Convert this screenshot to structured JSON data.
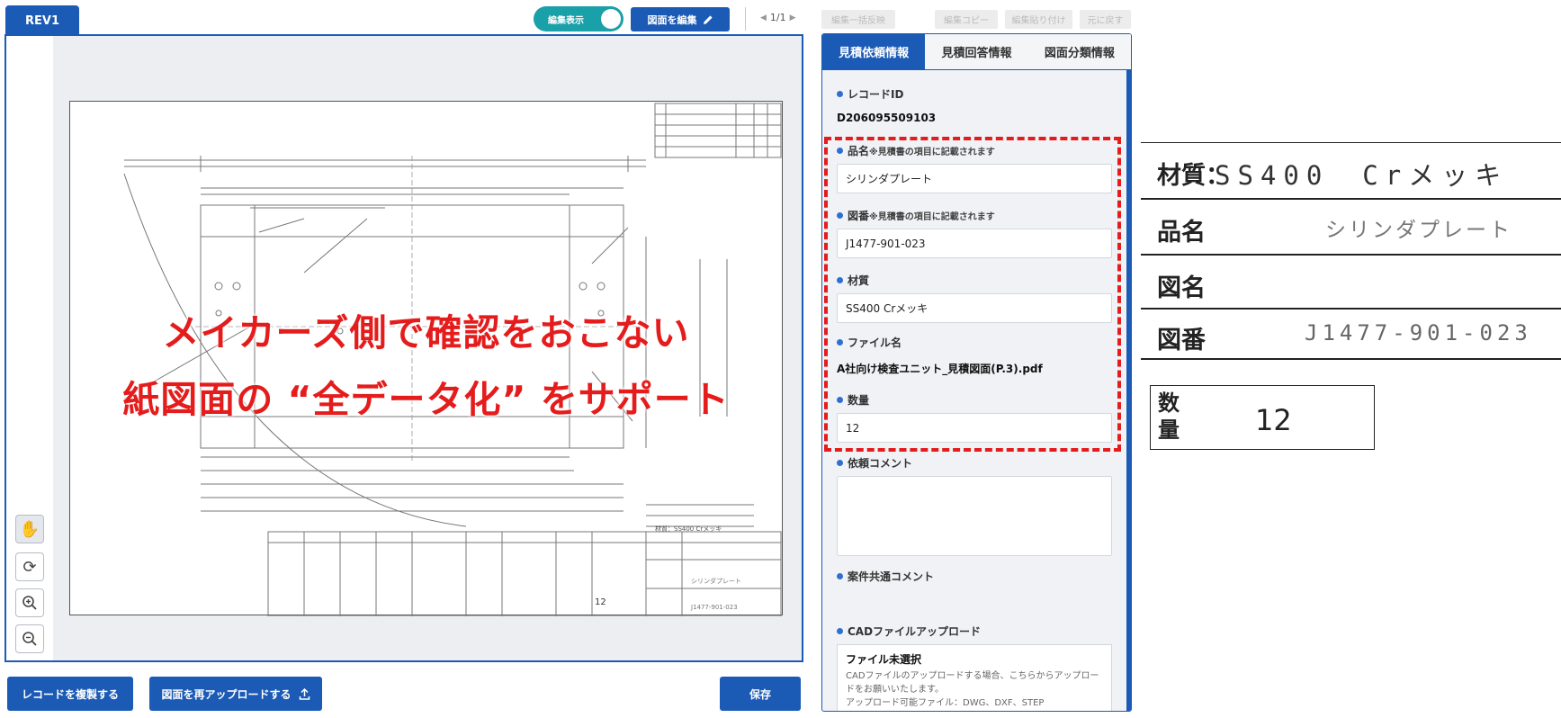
{
  "viewer": {
    "rev_tab": "REV1",
    "toggle_label": "編集表示",
    "edit_drawing_button": "図面を編集",
    "page_indicator": "1/1",
    "overlay_line1": "メイカーズ側で確認をおこない",
    "overlay_line2": "紙図面の “全データ化” をサポート",
    "drawing_material_note": "材質：SS400 Crメッキ",
    "drawing_quantity": "12",
    "drawing_part_name": "シリンダプレート",
    "drawing_number": "J1477-901-023"
  },
  "toolbar": {
    "bulk_apply": "編集一括反映",
    "copy_edit": "編集コピー",
    "paste_edit": "編集貼り付け",
    "undo": "元に戻す"
  },
  "bottom_buttons": {
    "duplicate_record": "レコードを複製する",
    "reupload_drawing": "図面を再アップロードする",
    "save": "保存"
  },
  "panel": {
    "tabs": [
      "見積依頼情報",
      "見積回答情報",
      "図面分類情報"
    ],
    "active_tab": 0,
    "record_id_label": "レコードID",
    "record_id_value": "D206095509103",
    "part_name_label": "品名",
    "part_name_note": "※見積書の項目に記載されます",
    "part_name_value": "シリンダプレート",
    "drawing_no_label": "図番",
    "drawing_no_note": "※見積書の項目に記載されます",
    "drawing_no_value": "J1477-901-023",
    "material_label": "材質",
    "material_value": "SS400 Crメッキ",
    "file_name_label": "ファイル名",
    "file_name_value": "A社向け検査ユニット_見積図面(P.3).pdf",
    "quantity_label": "数量",
    "quantity_value": "12",
    "request_comment_label": "依頼コメント",
    "shared_comment_label": "案件共通コメント",
    "cad_upload_label": "CADファイルアップロード",
    "cad_status": "ファイル未選択",
    "cad_desc_1": "CADファイルのアップロードする場合、こちらからアップロードをお願いいたします。",
    "cad_desc_2": "アップロード可能ファイル：DWG、DXF、STEP"
  },
  "zoom": {
    "material_label": "材質：",
    "material_value": "SS400　Crメッキ",
    "part_name_label": "品名",
    "part_name_value": "シリンダプレート",
    "drawing_name_label": "図名",
    "drawing_no_label": "図番",
    "drawing_no_value": "J1477-901-023",
    "quantity_label": "数量",
    "quantity_value": "12"
  },
  "colors": {
    "primary": "#1c5bb5",
    "toggle": "#1aa0a8",
    "highlight": "#e41c1c",
    "panel_bg": "#f0f2f5"
  },
  "icons": {
    "edit": "pencil-icon",
    "upload": "upload-icon",
    "hand": "hand-icon",
    "rotate": "rotate-icon",
    "zoom_in": "zoom-in-icon",
    "zoom_out": "zoom-out-icon"
  }
}
